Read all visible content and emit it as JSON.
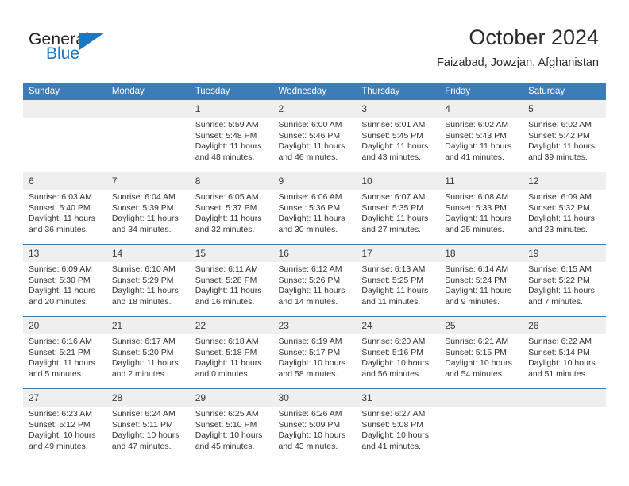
{
  "brand": {
    "name_top": "General",
    "name_bottom": "Blue",
    "triangle_icon": "triangle-icon",
    "colors": {
      "blue": "#1f77bf",
      "dark": "#231f20"
    }
  },
  "header": {
    "title": "October 2024",
    "subtitle": "Faizabad, Jowzjan, Afghanistan"
  },
  "calendar": {
    "accent_color": "#3c7cb9",
    "daynum_band_color": "#efefef",
    "weekday_headers": [
      "Sunday",
      "Monday",
      "Tuesday",
      "Wednesday",
      "Thursday",
      "Friday",
      "Saturday"
    ],
    "weeks": [
      [
        {
          "day": "",
          "blank": true
        },
        {
          "day": "",
          "blank": true
        },
        {
          "day": "1",
          "sunrise": "Sunrise: 5:59 AM",
          "sunset": "Sunset: 5:48 PM",
          "daylight": "Daylight: 11 hours and 48 minutes."
        },
        {
          "day": "2",
          "sunrise": "Sunrise: 6:00 AM",
          "sunset": "Sunset: 5:46 PM",
          "daylight": "Daylight: 11 hours and 46 minutes."
        },
        {
          "day": "3",
          "sunrise": "Sunrise: 6:01 AM",
          "sunset": "Sunset: 5:45 PM",
          "daylight": "Daylight: 11 hours and 43 minutes."
        },
        {
          "day": "4",
          "sunrise": "Sunrise: 6:02 AM",
          "sunset": "Sunset: 5:43 PM",
          "daylight": "Daylight: 11 hours and 41 minutes."
        },
        {
          "day": "5",
          "sunrise": "Sunrise: 6:02 AM",
          "sunset": "Sunset: 5:42 PM",
          "daylight": "Daylight: 11 hours and 39 minutes."
        }
      ],
      [
        {
          "day": "6",
          "sunrise": "Sunrise: 6:03 AM",
          "sunset": "Sunset: 5:40 PM",
          "daylight": "Daylight: 11 hours and 36 minutes."
        },
        {
          "day": "7",
          "sunrise": "Sunrise: 6:04 AM",
          "sunset": "Sunset: 5:39 PM",
          "daylight": "Daylight: 11 hours and 34 minutes."
        },
        {
          "day": "8",
          "sunrise": "Sunrise: 6:05 AM",
          "sunset": "Sunset: 5:37 PM",
          "daylight": "Daylight: 11 hours and 32 minutes."
        },
        {
          "day": "9",
          "sunrise": "Sunrise: 6:06 AM",
          "sunset": "Sunset: 5:36 PM",
          "daylight": "Daylight: 11 hours and 30 minutes."
        },
        {
          "day": "10",
          "sunrise": "Sunrise: 6:07 AM",
          "sunset": "Sunset: 5:35 PM",
          "daylight": "Daylight: 11 hours and 27 minutes."
        },
        {
          "day": "11",
          "sunrise": "Sunrise: 6:08 AM",
          "sunset": "Sunset: 5:33 PM",
          "daylight": "Daylight: 11 hours and 25 minutes."
        },
        {
          "day": "12",
          "sunrise": "Sunrise: 6:09 AM",
          "sunset": "Sunset: 5:32 PM",
          "daylight": "Daylight: 11 hours and 23 minutes."
        }
      ],
      [
        {
          "day": "13",
          "sunrise": "Sunrise: 6:09 AM",
          "sunset": "Sunset: 5:30 PM",
          "daylight": "Daylight: 11 hours and 20 minutes."
        },
        {
          "day": "14",
          "sunrise": "Sunrise: 6:10 AM",
          "sunset": "Sunset: 5:29 PM",
          "daylight": "Daylight: 11 hours and 18 minutes."
        },
        {
          "day": "15",
          "sunrise": "Sunrise: 6:11 AM",
          "sunset": "Sunset: 5:28 PM",
          "daylight": "Daylight: 11 hours and 16 minutes."
        },
        {
          "day": "16",
          "sunrise": "Sunrise: 6:12 AM",
          "sunset": "Sunset: 5:26 PM",
          "daylight": "Daylight: 11 hours and 14 minutes."
        },
        {
          "day": "17",
          "sunrise": "Sunrise: 6:13 AM",
          "sunset": "Sunset: 5:25 PM",
          "daylight": "Daylight: 11 hours and 11 minutes."
        },
        {
          "day": "18",
          "sunrise": "Sunrise: 6:14 AM",
          "sunset": "Sunset: 5:24 PM",
          "daylight": "Daylight: 11 hours and 9 minutes."
        },
        {
          "day": "19",
          "sunrise": "Sunrise: 6:15 AM",
          "sunset": "Sunset: 5:22 PM",
          "daylight": "Daylight: 11 hours and 7 minutes."
        }
      ],
      [
        {
          "day": "20",
          "sunrise": "Sunrise: 6:16 AM",
          "sunset": "Sunset: 5:21 PM",
          "daylight": "Daylight: 11 hours and 5 minutes."
        },
        {
          "day": "21",
          "sunrise": "Sunrise: 6:17 AM",
          "sunset": "Sunset: 5:20 PM",
          "daylight": "Daylight: 11 hours and 2 minutes."
        },
        {
          "day": "22",
          "sunrise": "Sunrise: 6:18 AM",
          "sunset": "Sunset: 5:18 PM",
          "daylight": "Daylight: 11 hours and 0 minutes."
        },
        {
          "day": "23",
          "sunrise": "Sunrise: 6:19 AM",
          "sunset": "Sunset: 5:17 PM",
          "daylight": "Daylight: 10 hours and 58 minutes."
        },
        {
          "day": "24",
          "sunrise": "Sunrise: 6:20 AM",
          "sunset": "Sunset: 5:16 PM",
          "daylight": "Daylight: 10 hours and 56 minutes."
        },
        {
          "day": "25",
          "sunrise": "Sunrise: 6:21 AM",
          "sunset": "Sunset: 5:15 PM",
          "daylight": "Daylight: 10 hours and 54 minutes."
        },
        {
          "day": "26",
          "sunrise": "Sunrise: 6:22 AM",
          "sunset": "Sunset: 5:14 PM",
          "daylight": "Daylight: 10 hours and 51 minutes."
        }
      ],
      [
        {
          "day": "27",
          "sunrise": "Sunrise: 6:23 AM",
          "sunset": "Sunset: 5:12 PM",
          "daylight": "Daylight: 10 hours and 49 minutes."
        },
        {
          "day": "28",
          "sunrise": "Sunrise: 6:24 AM",
          "sunset": "Sunset: 5:11 PM",
          "daylight": "Daylight: 10 hours and 47 minutes."
        },
        {
          "day": "29",
          "sunrise": "Sunrise: 6:25 AM",
          "sunset": "Sunset: 5:10 PM",
          "daylight": "Daylight: 10 hours and 45 minutes."
        },
        {
          "day": "30",
          "sunrise": "Sunrise: 6:26 AM",
          "sunset": "Sunset: 5:09 PM",
          "daylight": "Daylight: 10 hours and 43 minutes."
        },
        {
          "day": "31",
          "sunrise": "Sunrise: 6:27 AM",
          "sunset": "Sunset: 5:08 PM",
          "daylight": "Daylight: 10 hours and 41 minutes."
        },
        {
          "day": "",
          "blank": true
        },
        {
          "day": "",
          "blank": true
        }
      ]
    ]
  }
}
